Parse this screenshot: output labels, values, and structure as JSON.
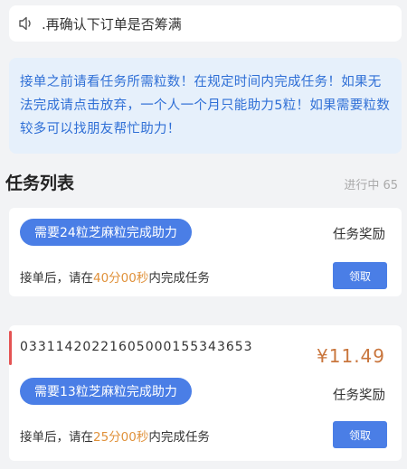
{
  "notice": {
    "icon": "speaker-icon",
    "text": ".再确认下订单是否筹满"
  },
  "info": {
    "text": "接单之前请看任务所需粒数！在规定时间内完成任务！如果无法完成请点击放弃，一个人一个月只能助力5粒！如果需要粒数较多可以找朋友帮忙助力！"
  },
  "section": {
    "title": "任务列表",
    "status": "进行中 65"
  },
  "tasks": [
    {
      "requirement": "需要24粒芝麻粒完成助力",
      "reward_label": "任务奖励",
      "deadline_prefix": "接单后，请在",
      "deadline_time": "40分00秒",
      "deadline_suffix": "内完成任务",
      "claim_label": "领取"
    },
    {
      "order_id": "03311420221605000155343653",
      "price": "¥11.49",
      "requirement": "需要13粒芝麻粒完成助力",
      "reward_label": "任务奖励",
      "deadline_prefix": "接单后，请在",
      "deadline_time": "25分00秒",
      "deadline_suffix": "内完成任务",
      "claim_label": "领取"
    }
  ],
  "colors": {
    "accent": "#4a7ee6",
    "info_text": "#2f6fd6",
    "info_bg": "#e6f0fb",
    "price": "#c9763d",
    "highlight": "#e0913a"
  }
}
